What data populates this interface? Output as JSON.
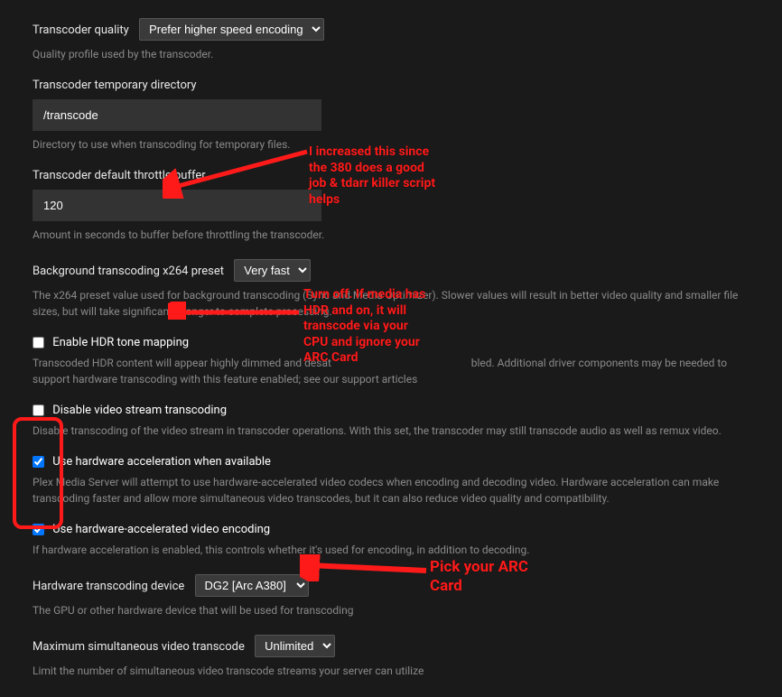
{
  "settings": {
    "transcoder_quality": {
      "label": "Transcoder quality",
      "selected": "Prefer higher speed encoding",
      "help": "Quality profile used by the transcoder."
    },
    "temp_dir": {
      "label": "Transcoder temporary directory",
      "value": "/transcode",
      "help": "Directory to use when transcoding for temporary files."
    },
    "throttle_buffer": {
      "label": "Transcoder default throttle buffer",
      "value": "120",
      "help": "Amount in seconds to buffer before throttling the transcoder."
    },
    "x264_preset": {
      "label": "Background transcoding x264 preset",
      "selected": "Very fast",
      "help": "The x264 preset value used for background transcoding (Sync and Media Optimizer). Slower values will result in better video quality and smaller file sizes, but will take significantly longer to complete processing."
    },
    "hdr_tone_mapping": {
      "label": "Enable HDR tone mapping",
      "checked": false,
      "help_prefix": "Transcoded HDR content will appear highly dimmed and desat",
      "help_suffix": "bled. Additional driver components may be needed to support hardware transcoding with this feature enabled; see our support articles"
    },
    "disable_video_stream": {
      "label": "Disable video stream transcoding",
      "checked": false,
      "help": "Disable transcoding of the video stream in transcoder operations. With this set, the transcoder may still transcode audio as well as remux video."
    },
    "hw_accel": {
      "label": "Use hardware acceleration when available",
      "checked": true,
      "help": "Plex Media Server will attempt to use hardware-accelerated video codecs when encoding and decoding video. Hardware acceleration can make transcoding faster and allow more simultaneous video transcodes, but it can also reduce video quality and compatibility."
    },
    "hw_encode": {
      "label": "Use hardware-accelerated video encoding",
      "checked": true,
      "help": "If hardware acceleration is enabled, this controls whether it's used for encoding, in addition to decoding."
    },
    "hw_device": {
      "label": "Hardware transcoding device",
      "selected": "DG2 [Arc A380]",
      "help": "The GPU or other hardware device that will be used for transcoding"
    },
    "max_transcode": {
      "label": "Maximum simultaneous video transcode",
      "selected": "Unlimited",
      "help": "Limit the number of simultaneous video transcode streams your server can utilize"
    }
  },
  "annotations": {
    "throttle": "I increased this since the 380 does a good job & tdarr killer script helps",
    "hdr": "Turn off. If media has HDR and on, it will transcode via your CPU and ignore your ARC Card",
    "device": "Pick your ARC Card"
  }
}
